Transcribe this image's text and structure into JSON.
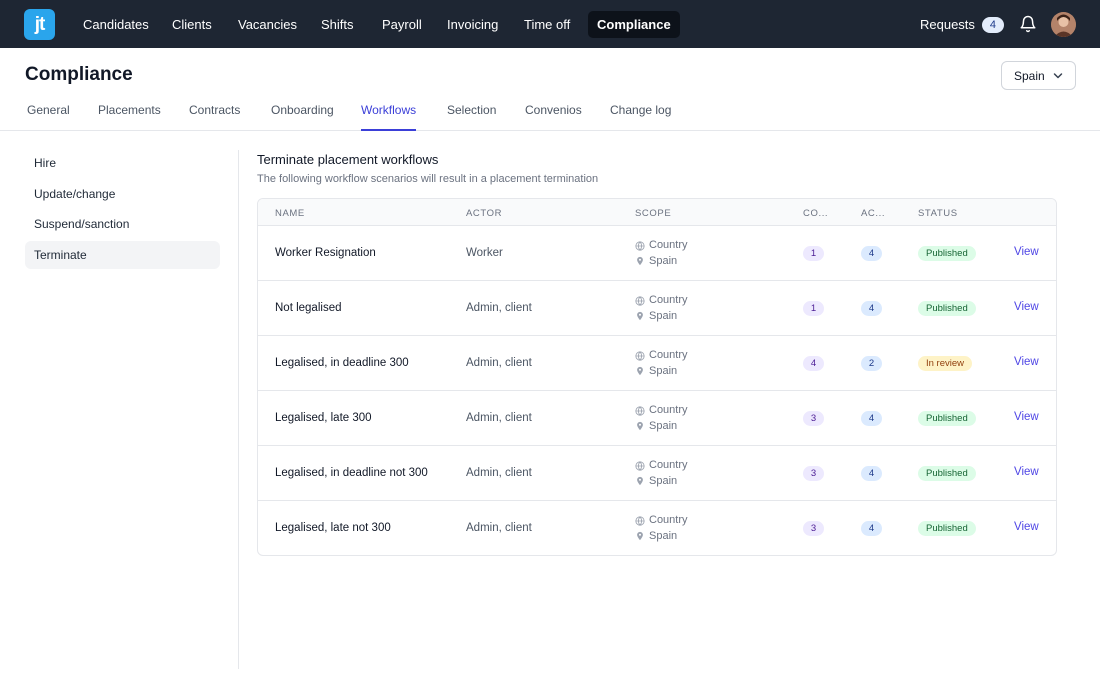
{
  "app": {
    "logo_text": "jt"
  },
  "topnav": {
    "items": [
      {
        "label": "Candidates"
      },
      {
        "label": "Clients"
      },
      {
        "label": "Vacancies"
      },
      {
        "label": "Shifts"
      },
      {
        "label": "Payroll"
      },
      {
        "label": "Invoicing"
      },
      {
        "label": "Time off"
      },
      {
        "label": "Compliance",
        "active": true
      }
    ],
    "requests_label": "Requests",
    "requests_count": "4",
    "icons": [
      "bell-icon",
      "avatar"
    ]
  },
  "header": {
    "title": "Compliance",
    "country_select": {
      "value": "Spain",
      "icon": "chevron-down-icon"
    }
  },
  "tabs": [
    {
      "label": "General"
    },
    {
      "label": "Placements"
    },
    {
      "label": "Contracts"
    },
    {
      "label": "Onboarding"
    },
    {
      "label": "Workflows",
      "active": true
    },
    {
      "label": "Selection"
    },
    {
      "label": "Convenios"
    },
    {
      "label": "Change log"
    }
  ],
  "sidebar": {
    "items": [
      {
        "label": "Hire"
      },
      {
        "label": "Update/change"
      },
      {
        "label": "Suspend/sanction"
      },
      {
        "label": "Terminate",
        "active": true
      }
    ]
  },
  "section": {
    "title": "Terminate placement workflows",
    "description": "The following workflow scenarios will result in a placement termination"
  },
  "table": {
    "columns": {
      "name": "Name",
      "actor": "Actor",
      "scope": "Scope",
      "co": "Co...",
      "ac": "Ac...",
      "status": "Status"
    },
    "rows": [
      {
        "name": "Worker Resignation",
        "actor": "Worker",
        "scope_type": "Country",
        "scope_location": "Spain",
        "co": "1",
        "ac": "4",
        "status": "Published",
        "action": "View"
      },
      {
        "name": "Not legalised",
        "actor": "Admin, client",
        "scope_type": "Country",
        "scope_location": "Spain",
        "co": "1",
        "ac": "4",
        "status": "Published",
        "action": "View"
      },
      {
        "name": "Legalised, in deadline 300",
        "actor": "Admin, client",
        "scope_type": "Country",
        "scope_location": "Spain",
        "co": "4",
        "ac": "2",
        "status": "In review",
        "action": "View"
      },
      {
        "name": "Legalised, late 300",
        "actor": "Admin, client",
        "scope_type": "Country",
        "scope_location": "Spain",
        "co": "3",
        "ac": "4",
        "status": "Published",
        "action": "View"
      },
      {
        "name": "Legalised, in deadline not 300",
        "actor": "Admin, client",
        "scope_type": "Country",
        "scope_location": "Spain",
        "co": "3",
        "ac": "4",
        "status": "Published",
        "action": "View"
      },
      {
        "name": "Legalised, late not 300",
        "actor": "Admin, client",
        "scope_type": "Country",
        "scope_location": "Spain",
        "co": "3",
        "ac": "4",
        "status": "Published",
        "action": "View"
      }
    ]
  },
  "colors": {
    "nav_bg": "#1e2633",
    "accent": "#3b3fd8",
    "published_bg": "#dcfce7",
    "review_bg": "#fef3c7"
  }
}
